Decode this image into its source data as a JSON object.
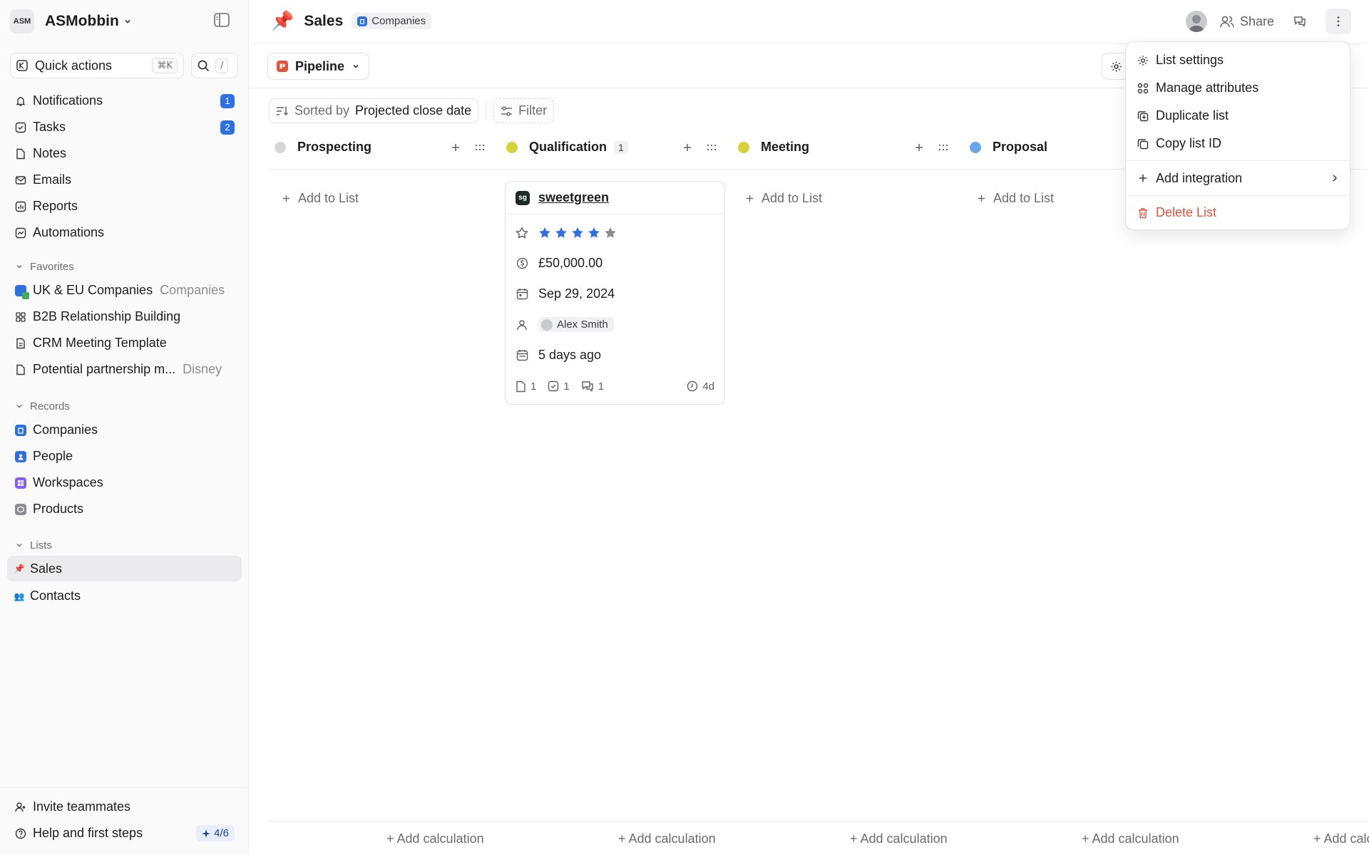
{
  "workspace": {
    "name": "ASMobbin",
    "logo": "ASM"
  },
  "quick_actions": {
    "label": "Quick actions",
    "shortcut": "⌘K",
    "search_shortcut": "/"
  },
  "nav": [
    {
      "label": "Notifications",
      "icon": "bell-icon",
      "badge": "1"
    },
    {
      "label": "Tasks",
      "icon": "checkbox-icon",
      "badge": "2"
    },
    {
      "label": "Notes",
      "icon": "note-icon"
    },
    {
      "label": "Emails",
      "icon": "mail-icon"
    },
    {
      "label": "Reports",
      "icon": "chart-icon"
    },
    {
      "label": "Automations",
      "icon": "automation-icon"
    }
  ],
  "favorites": {
    "title": "Favorites",
    "items": [
      {
        "label": "UK & EU Companies",
        "suffix": "Companies"
      },
      {
        "label": "B2B Relationship Building"
      },
      {
        "label": "CRM Meeting Template"
      },
      {
        "label": "Potential partnership m...",
        "suffix": "Disney"
      }
    ]
  },
  "records": {
    "title": "Records",
    "items": [
      {
        "label": "Companies",
        "color": "#2f6fe4"
      },
      {
        "label": "People",
        "color": "#2f6fe4"
      },
      {
        "label": "Workspaces",
        "color": "#8a5cf6"
      },
      {
        "label": "Products",
        "color": "#8b8c92"
      }
    ]
  },
  "lists": {
    "title": "Lists",
    "items": [
      {
        "label": "Sales",
        "emoji": "📌"
      },
      {
        "label": "Contacts",
        "emoji": "👥"
      }
    ]
  },
  "footer": {
    "invite": "Invite teammates",
    "help": "Help and first steps",
    "progress": "4/6"
  },
  "header": {
    "emoji": "📌",
    "title": "Sales",
    "object_chip": "Companies",
    "share": "Share"
  },
  "view": {
    "name": "Pipeline"
  },
  "sort": {
    "prefix": "Sorted by",
    "field": "Projected close date"
  },
  "filter": {
    "label": "Filter"
  },
  "columns": [
    {
      "name": "Prospecting",
      "color": "#d6d6da",
      "count": ""
    },
    {
      "name": "Qualification",
      "color": "#d4d43a",
      "count": "1"
    },
    {
      "name": "Meeting",
      "color": "#d4d43a",
      "count": ""
    },
    {
      "name": "Proposal",
      "color": "#6aa7e8",
      "count": ""
    }
  ],
  "add_to_list": "Add to List",
  "card": {
    "logo": "sg",
    "name": "sweetgreen",
    "rating": 4,
    "rating_max": 5,
    "amount": "£50,000.00",
    "close_date": "Sep 29, 2024",
    "owner": "Alex Smith",
    "last_activity": "5 days ago",
    "notes": "1",
    "tasks": "1",
    "comments": "1",
    "age": "4d"
  },
  "add_calculation": [
    "+ Add calculation",
    "+ Add calculation",
    "+ Add calculation",
    "+ Add calculation",
    "+ Add calcu"
  ],
  "menu": {
    "list_settings": "List settings",
    "manage_attributes": "Manage attributes",
    "duplicate_list": "Duplicate list",
    "copy_list_id": "Copy list ID",
    "add_integration": "Add integration",
    "delete_list": "Delete List"
  }
}
